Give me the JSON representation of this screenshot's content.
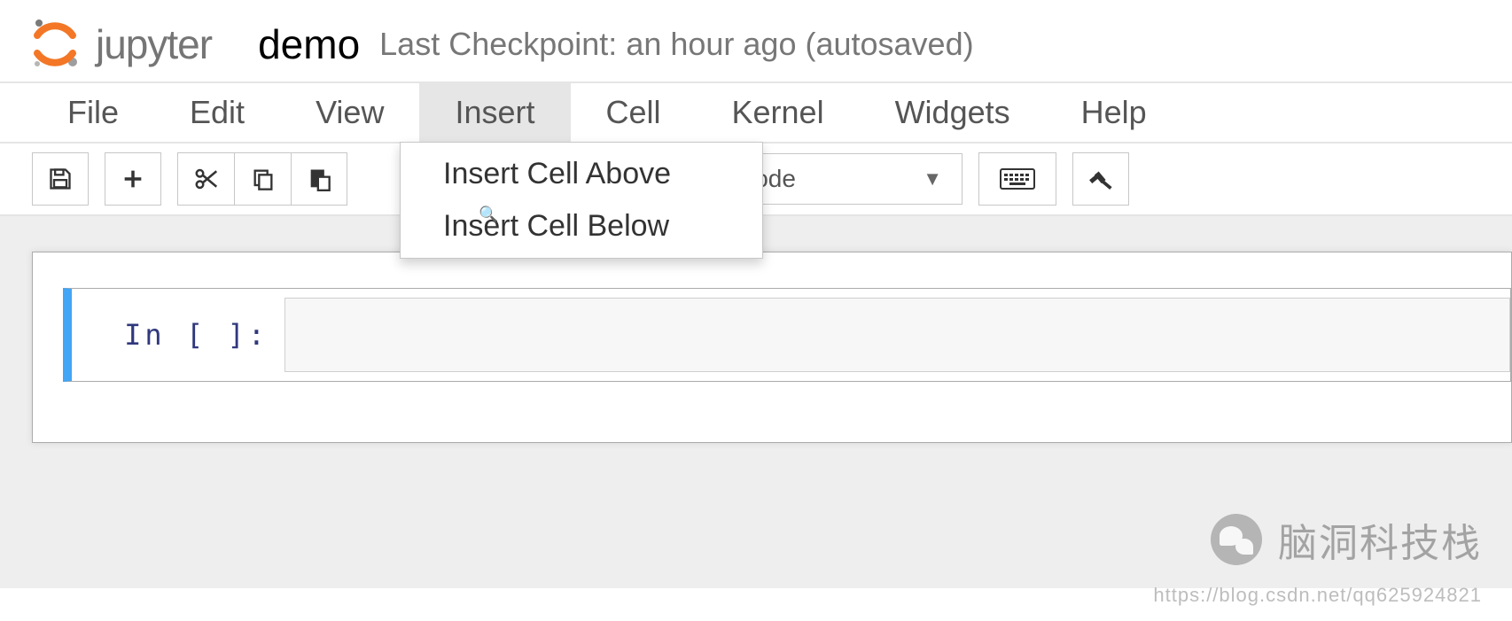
{
  "header": {
    "logo_text": "jupyter",
    "notebook_name": "demo",
    "checkpoint": "Last Checkpoint: an hour ago (autosaved)"
  },
  "menubar": {
    "items": [
      "File",
      "Edit",
      "View",
      "Insert",
      "Cell",
      "Kernel",
      "Widgets",
      "Help"
    ],
    "active_index": 3
  },
  "dropdown": {
    "items": [
      "Insert Cell Above",
      "Insert Cell Below"
    ]
  },
  "toolbar": {
    "celltype": "Code"
  },
  "cell": {
    "prompt": "In [ ]:"
  },
  "watermark": {
    "text": "脑洞科技栈",
    "url": "https://blog.csdn.net/qq625924821"
  }
}
